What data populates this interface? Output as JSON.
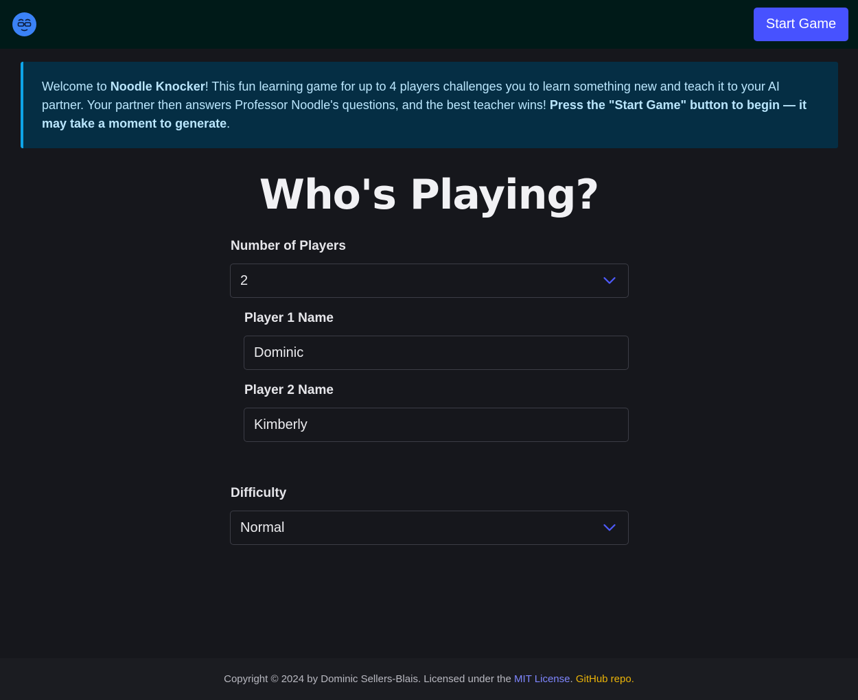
{
  "header": {
    "logo_icon": "noodle-face-logo-icon",
    "start_button": "Start Game"
  },
  "alert": {
    "text_1": "Welcome to ",
    "brand": "Noodle Knocker",
    "text_2": "! This fun learning game for up to 4 players challenges you to learn something new and teach it to your AI partner. Your partner then answers Professor Noodle's questions, and the best teacher wins! ",
    "emphasis": "Press the \"Start Game\" button to begin — it may take a moment to generate",
    "text_3": "."
  },
  "title": "Who's Playing?",
  "form": {
    "players_label": "Number of Players",
    "players_value": "2",
    "player1_label": "Player 1 Name",
    "player1_value": "Dominic",
    "player2_label": "Player 2 Name",
    "player2_value": "Kimberly",
    "difficulty_label": "Difficulty",
    "difficulty_value": "Normal"
  },
  "footer": {
    "copyright": "Copyright © 2024 by Dominic Sellers-Blais. Licensed under the ",
    "mit_link": "MIT License",
    "sep": ". ",
    "github_link": "GitHub repo."
  },
  "colors": {
    "accent": "#4752ff",
    "alert_bg": "#052e44",
    "alert_border": "#0ea5e9",
    "github_link": "#eab308"
  }
}
